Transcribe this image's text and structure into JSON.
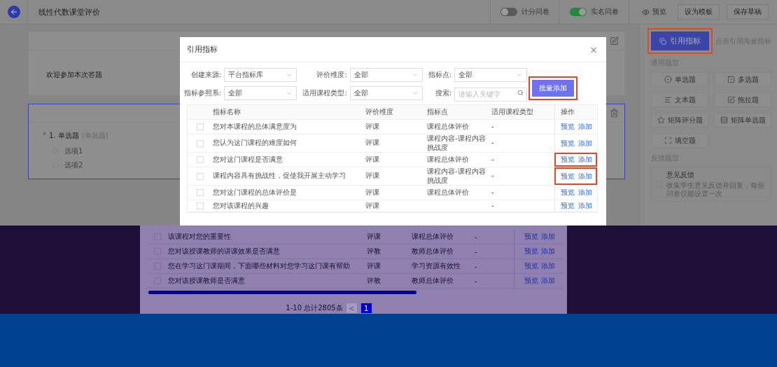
{
  "header": {
    "title": "线性代数课堂评价",
    "toggles": [
      {
        "label": "计分问卷",
        "on": false
      },
      {
        "label": "实名问卷",
        "on": true
      }
    ],
    "preview": "预览",
    "buttons": [
      "设为模板",
      "保存草稿"
    ]
  },
  "survey": {
    "welcome": "欢迎参加本次答题",
    "question": {
      "number": "1.",
      "title": "单选题",
      "type_hint": "(单选题)",
      "required_mark": "*",
      "options": [
        {
          "label": "选项1",
          "selected": false
        },
        {
          "label": "选项2",
          "selected": false
        }
      ]
    }
  },
  "sidebar": {
    "cite_button": {
      "label": "引用指标",
      "highlighted": true
    },
    "cite_hint": "点击引用海量指标",
    "general_title": "通用题型",
    "general_types": [
      {
        "label": "单选题",
        "kind": "radio"
      },
      {
        "label": "多选题",
        "kind": "checkbox"
      },
      {
        "label": "文本题",
        "kind": "text"
      },
      {
        "label": "拖拉题",
        "kind": "drag"
      },
      {
        "label": "矩阵评分题",
        "kind": "star"
      },
      {
        "label": "矩阵单选题",
        "kind": "matrix"
      },
      {
        "label": "填空题",
        "kind": "blank"
      }
    ],
    "feedback_title": "反馈题型",
    "feedback": {
      "title": "意见反馈",
      "description": "收集学生意见反馈并回复，每份问卷仅能设置一次",
      "checked": false
    }
  },
  "dialog": {
    "title": "引用指标",
    "close": "×",
    "filters": [
      {
        "label": "创建来源:",
        "value": "平台指标库"
      },
      {
        "label": "评价维度:",
        "value": "全部"
      },
      {
        "label": "指标点:",
        "value": "全部"
      },
      {
        "label": "指标参照系:",
        "value": "全部"
      },
      {
        "label": "适用课程类型:",
        "value": "全部"
      }
    ],
    "search": {
      "label": "搜索:",
      "placeholder": "请输入关键字"
    },
    "batch_button": {
      "label": "批量添加",
      "highlighted": true
    },
    "table": {
      "columns": [
        "指标名称",
        "评价维度",
        "指标点",
        "适用课程类型",
        "操作"
      ],
      "rows": [
        {
          "name": "您对本课程的总体满意度为",
          "dimension": "评课",
          "point": "课程总体评价",
          "course_type": "-",
          "actions": [
            "预览",
            "添加"
          ],
          "checked": false,
          "highlighted": false
        },
        {
          "name": "您认为这门课程的难度如何",
          "dimension": "评课",
          "point": "课程内容-课程内容挑战度",
          "course_type": "-",
          "actions": [
            "预览",
            "添加"
          ],
          "checked": false,
          "highlighted": false
        },
        {
          "name": "您对这门课程是否满意",
          "dimension": "评课",
          "point": "课程总体评价",
          "course_type": "-",
          "actions": [
            "预览",
            "添加"
          ],
          "checked": false,
          "highlighted": true
        },
        {
          "name": "课程内容具有挑战性，促使我开展主动学习",
          "dimension": "评课",
          "point": "课程内容-课程内容挑战度",
          "course_type": "-",
          "actions": [
            "预览",
            "添加"
          ],
          "checked": false,
          "highlighted": true
        },
        {
          "name": "您对这门课程的总体评价是",
          "dimension": "评课",
          "point": "课程总体评价",
          "course_type": "-",
          "actions": [
            "预览",
            "添加"
          ],
          "checked": false,
          "highlighted": false
        },
        {
          "name": "您对该课程的兴趣",
          "dimension": "评课",
          "course_type": "-",
          "actions": [
            "预览",
            "添加"
          ],
          "checked": false,
          "highlighted": false
        },
        {
          "name": "该课程对您的重要性",
          "dimension": "评课",
          "point": "课程总体评价",
          "course_type": "-",
          "actions": [
            "预览",
            "添加"
          ],
          "checked": false,
          "highlighted": false
        },
        {
          "name": "您对该授课教师的讲课效果是否满意",
          "dimension": "评教",
          "point": "教师总体评价",
          "course_type": "-",
          "actions": [
            "预览",
            "添加"
          ],
          "checked": false,
          "highlighted": false
        },
        {
          "name": "您在学习这门课期间，下面哪些材料对您学习这门课有帮助",
          "dimension": "评课",
          "point": "学习资源有效性",
          "course_type": "-",
          "actions": [
            "预览",
            "添加"
          ],
          "checked": false,
          "highlighted": false
        },
        {
          "name": "您对该授课教师是否满意",
          "dimension": "评教",
          "point": "教师总体评价",
          "course_type": "-",
          "actions": [
            "预览",
            "添加"
          ],
          "checked": false,
          "highlighted": false
        }
      ]
    },
    "pagination": {
      "summary": "1-10 总计2805条",
      "prev": "<",
      "pages": [
        {
          "label": "1",
          "selected": true
        }
      ]
    }
  }
}
